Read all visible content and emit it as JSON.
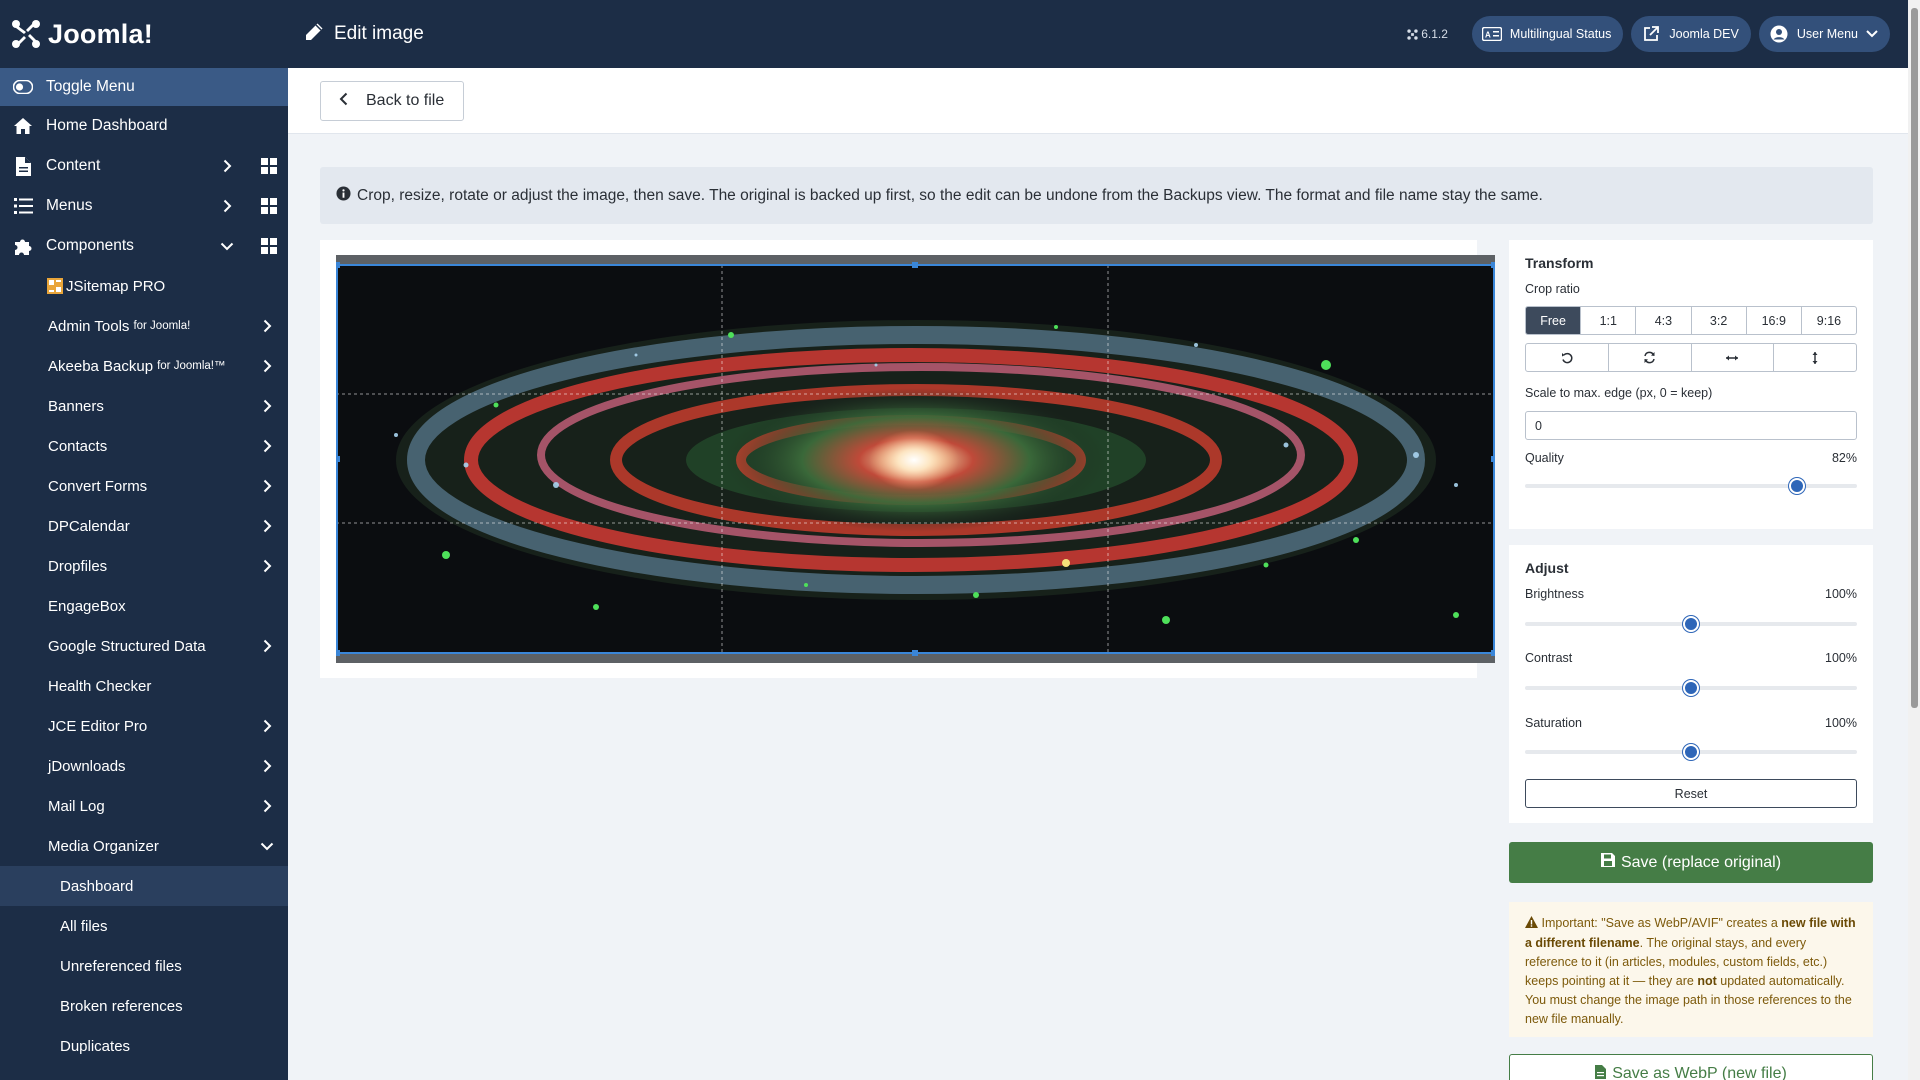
{
  "brand": {
    "name": "Joomla!"
  },
  "sidebar": {
    "toggle_label": "Toggle Menu",
    "items": [
      {
        "label": "Home Dashboard"
      },
      {
        "label": "Content"
      },
      {
        "label": "Menus"
      },
      {
        "label": "Components"
      }
    ],
    "components": [
      {
        "label": "JSitemap PRO"
      },
      {
        "label": "Admin Tools",
        "suffix": "for Joomla!"
      },
      {
        "label": "Akeeba Backup",
        "suffix": "for Joomla!™"
      },
      {
        "label": "Banners"
      },
      {
        "label": "Contacts"
      },
      {
        "label": "Convert Forms"
      },
      {
        "label": "DPCalendar"
      },
      {
        "label": "Dropfiles"
      },
      {
        "label": "EngageBox"
      },
      {
        "label": "Google Structured Data"
      },
      {
        "label": "Health Checker"
      },
      {
        "label": "JCE Editor Pro"
      },
      {
        "label": "jDownloads"
      },
      {
        "label": "Mail Log"
      },
      {
        "label": "Media Organizer"
      }
    ],
    "media_organizer": [
      {
        "label": "Dashboard"
      },
      {
        "label": "All files"
      },
      {
        "label": "Unreferenced files"
      },
      {
        "label": "Broken references"
      },
      {
        "label": "Duplicates"
      }
    ]
  },
  "header": {
    "title": "Edit image",
    "version": "6.1.2",
    "multilingual": "Multilingual Status",
    "site": "Joomla DEV",
    "user_menu": "User Menu"
  },
  "toolbar": {
    "back_label": "Back to file"
  },
  "alert": {
    "text": "Crop, resize, rotate or adjust the image, then save. The original is backed up first, so the edit can be undone from the Backups view. The format and file name stay the same."
  },
  "transform": {
    "title": "Transform",
    "crop_ratio_label": "Crop ratio",
    "ratios": [
      "Free",
      "1:1",
      "4:3",
      "3:2",
      "16:9",
      "9:16"
    ],
    "selected_ratio": "Free",
    "scale_label": "Scale to max. edge (px, 0 = keep)",
    "scale_value": "0",
    "quality_label": "Quality",
    "quality_value": "82%",
    "quality_fraction": 0.82
  },
  "adjust": {
    "title": "Adjust",
    "brightness_label": "Brightness",
    "brightness_value": "100%",
    "brightness_fraction": 0.5,
    "contrast_label": "Contrast",
    "contrast_value": "100%",
    "contrast_fraction": 0.5,
    "saturation_label": "Saturation",
    "saturation_value": "100%",
    "saturation_fraction": 0.5,
    "reset_label": "Reset"
  },
  "actions": {
    "save_label": "Save (replace original)",
    "warning_important": "Important:",
    "warning_q": "\"Save as WebP/AVIF\" creates a",
    "warning_bold1": "new file with a different filename",
    "warning_mid": ". The original stays, and every reference to it (in articles, modules, custom fields, etc.) keeps pointing at it — they are",
    "warning_not": "not",
    "warning_end": "updated automatically. You must change the image path in those references to the new file manually.",
    "webp_label": "Save as WebP (new file)"
  },
  "colors": {
    "sidebar": "#1c2d46",
    "accent": "#457d46",
    "slider": "#2e66b8"
  }
}
